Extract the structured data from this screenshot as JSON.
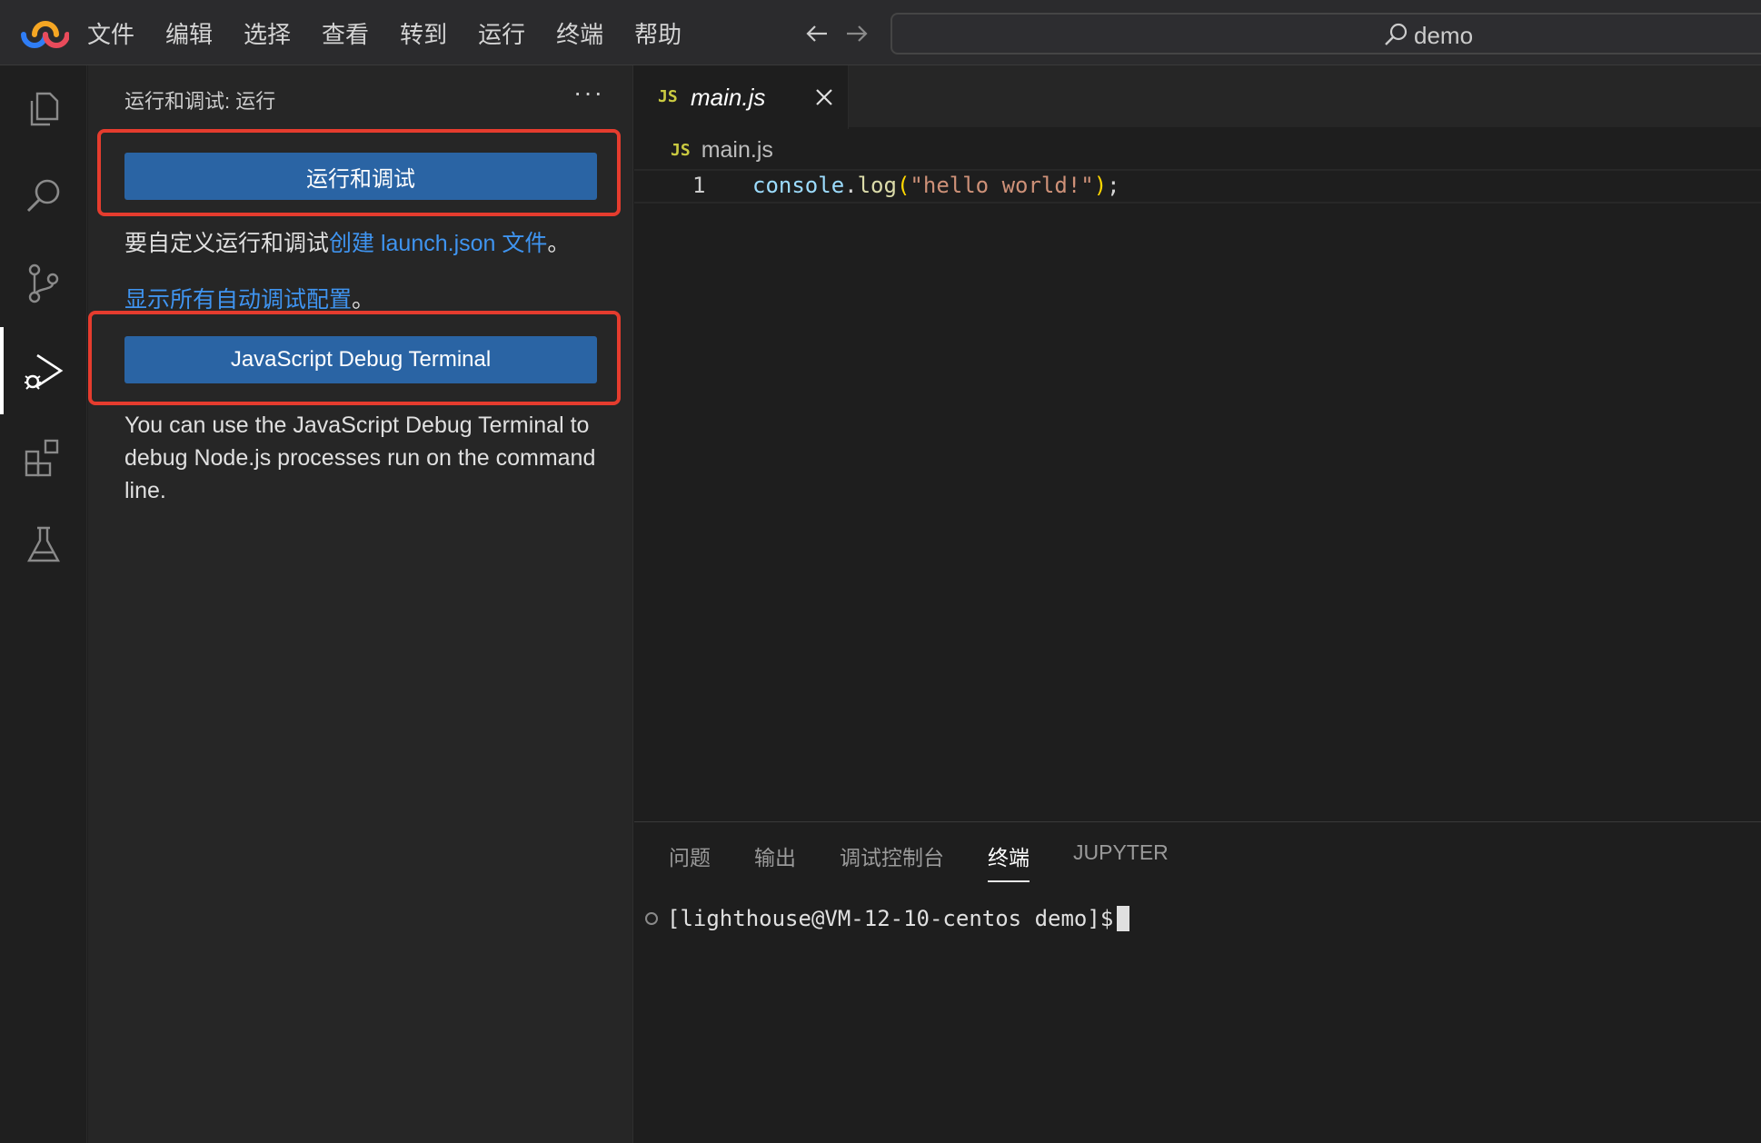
{
  "menubar": {
    "items": [
      "文件",
      "编辑",
      "选择",
      "查看",
      "转到",
      "运行",
      "终端",
      "帮助"
    ]
  },
  "command_center": {
    "label": "demo"
  },
  "sidebar": {
    "title": "运行和调试: 运行",
    "more": "···",
    "run_debug_button": "运行和调试",
    "customize_text": "要自定义运行和调试",
    "customize_link": "创建 launch.json 文件",
    "customize_end": "。",
    "show_all_link": "显示所有自动调试配置",
    "show_all_end": "。",
    "js_debug_button": "JavaScript Debug Terminal",
    "js_debug_description": "You can use the JavaScript Debug Terminal to debug Node.js processes run on the command line."
  },
  "editor": {
    "tab_badge": "JS",
    "tab_label": "main.js",
    "breadcrumb_badge": "JS",
    "breadcrumb_label": "main.js",
    "line_number": "1",
    "code": {
      "obj": "console",
      "dot": ".",
      "fn": "log",
      "open": "(",
      "str": "\"hello world!\"",
      "close": ")",
      "semi": ";"
    }
  },
  "panel": {
    "tabs": [
      "问题",
      "输出",
      "调试控制台",
      "终端",
      "JUPYTER"
    ],
    "active_tab": "终端",
    "terminal_prompt": "[lighthouse@VM-12-10-centos demo]$"
  },
  "colors": {
    "highlight": "#e53c2e",
    "button": "#2a64a4",
    "link": "#3f94f0"
  }
}
